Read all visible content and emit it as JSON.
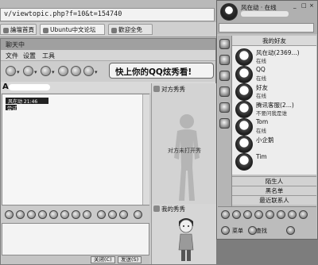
{
  "browser": {
    "address": "v/viewtopic.php?f=10&t=154740",
    "tabs": [
      "論壇首頁",
      "Ubuntu中文论坛",
      "歡迎全免"
    ]
  },
  "chat_window": {
    "title": "聊天中",
    "menu": [
      "文件",
      "设置",
      "工具"
    ],
    "contact_initial": "A",
    "banner": "快上你的QQ炫秀看!",
    "message_sender": "风在动 21:46",
    "message_text": "尝试",
    "show_pane_title": "对方秀秀",
    "show_caption": "对方未打开秀",
    "my_pane_title": "我的秀秀",
    "buttons": {
      "close": "关闭(C)",
      "send": "发送(S)"
    }
  },
  "qq": {
    "nickname": "风在动 · 在线",
    "window_buttons": [
      "_",
      "□",
      "×"
    ],
    "group_header": "我的好友",
    "contacts": [
      {
        "name": "风在动(2369...)",
        "sub": "在线"
      },
      {
        "name": "QQ",
        "sub": "在线"
      },
      {
        "name": "好友",
        "sub": "在线"
      },
      {
        "name": "腾讯客服(2...)",
        "sub": "不要问我是谁"
      },
      {
        "name": "Tom",
        "sub": "在线"
      },
      {
        "name": "小企鹅",
        "sub": ""
      },
      {
        "name": "Tim",
        "sub": ""
      }
    ],
    "groups": [
      "陌生人",
      "黑名单",
      "最近联系人"
    ],
    "bottom_labels": [
      "菜单",
      "查找"
    ]
  }
}
